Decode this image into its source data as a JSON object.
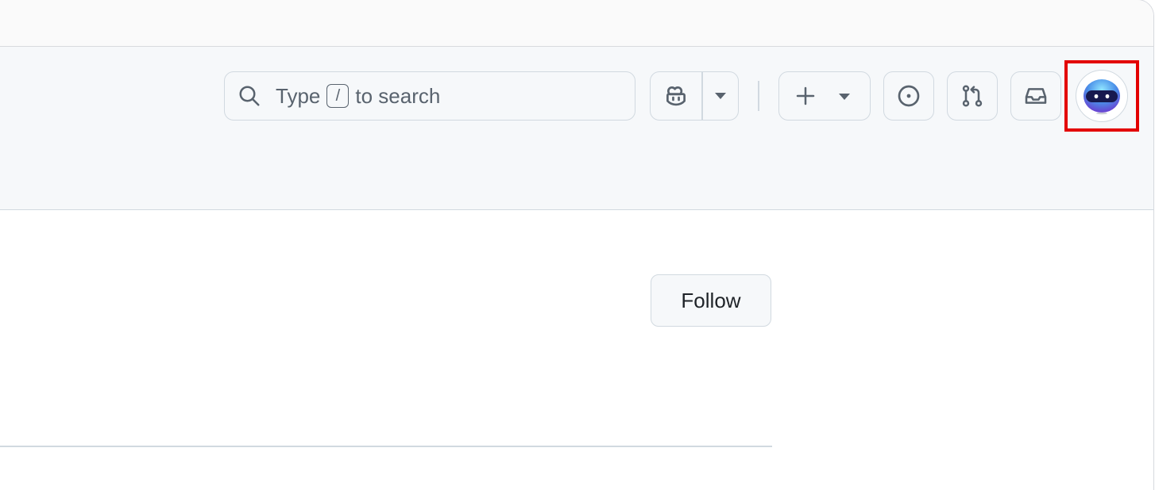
{
  "search": {
    "prefix": "Type",
    "shortcut_key": "/",
    "suffix": "to search"
  },
  "header_icons": {
    "copilot": "copilot-icon",
    "copilot_menu": "triangle-down-icon",
    "create": "plus-icon",
    "create_menu": "triangle-down-icon",
    "issues": "issue-opened-icon",
    "pull_requests": "git-pull-request-icon",
    "inbox": "inbox-icon"
  },
  "profile": {
    "follow_label": "Follow"
  },
  "colors": {
    "header_bg": "#f6f8fa",
    "border": "#d1d9e0",
    "icon": "#59636e",
    "highlight": "#e30000"
  }
}
